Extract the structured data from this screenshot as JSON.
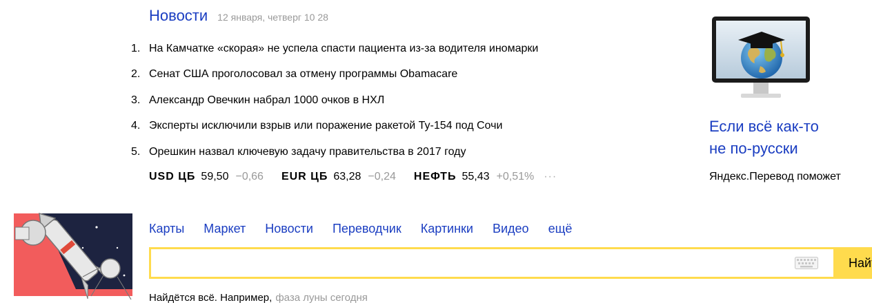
{
  "news": {
    "title": "Новости",
    "date": "12 января, четверг 10 28",
    "items": [
      {
        "num": "1.",
        "text": "На Камчатке «скорая» не успела спасти пациента из-за водителя иномарки"
      },
      {
        "num": "2.",
        "text": "Сенат США проголосовал за отмену программы Obamacare"
      },
      {
        "num": "3.",
        "text": "Александр Овечкин набрал 1000 очков в НХЛ"
      },
      {
        "num": "4.",
        "text": "Эксперты исключили взрыв или поражение ракетой Ту-154 под Сочи"
      },
      {
        "num": "5.",
        "text": "Орешкин назвал ключевую задачу правительства в 2017 году"
      }
    ]
  },
  "quotes": [
    {
      "name": "USD ЦБ",
      "value": "59,50",
      "delta": "−0,66"
    },
    {
      "name": "EUR ЦБ",
      "value": "63,28",
      "delta": "−0,24"
    },
    {
      "name": "НЕФТЬ",
      "value": "55,43",
      "delta": "+0,51%"
    }
  ],
  "quotes_more": "···",
  "promo": {
    "title_line1": "Если всё как-то",
    "title_line2": "не по-русски",
    "subtitle": "Яндекс.Перевод поможет"
  },
  "services": [
    "Карты",
    "Маркет",
    "Новости",
    "Переводчик",
    "Картинки",
    "Видео",
    "ещё"
  ],
  "search": {
    "value": "",
    "button_label": "Найти"
  },
  "hint": {
    "lead": "Найдётся всё. Например,",
    "example": "фаза луны сегодня"
  },
  "colors": {
    "link": "#1a3dc1",
    "accent_yellow": "#ffdb4d",
    "muted": "#999999"
  }
}
